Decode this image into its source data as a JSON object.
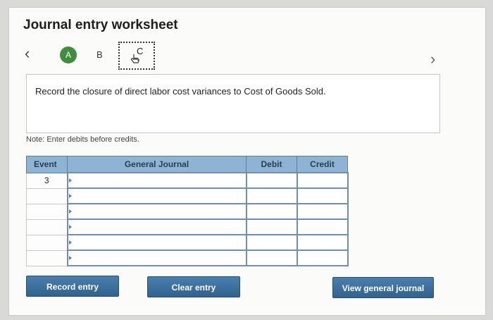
{
  "worksheet": {
    "title": "Journal entry worksheet",
    "steps": [
      {
        "label": "A",
        "state": "completed"
      },
      {
        "label": "B",
        "state": "pending"
      },
      {
        "label": "C",
        "state": "active"
      }
    ],
    "instruction": "Record the closure of direct labor cost variances to Cost of Goods Sold.",
    "note": "Note: Enter debits before credits."
  },
  "table": {
    "headers": {
      "event": "Event",
      "journal": "General Journal",
      "debit": "Debit",
      "credit": "Credit"
    },
    "rows": [
      {
        "event": "3",
        "journal": "",
        "debit": "",
        "credit": ""
      },
      {
        "event": "",
        "journal": "",
        "debit": "",
        "credit": ""
      },
      {
        "event": "",
        "journal": "",
        "debit": "",
        "credit": ""
      },
      {
        "event": "",
        "journal": "",
        "debit": "",
        "credit": ""
      },
      {
        "event": "",
        "journal": "",
        "debit": "",
        "credit": ""
      },
      {
        "event": "",
        "journal": "",
        "debit": "",
        "credit": ""
      }
    ]
  },
  "buttons": {
    "record": "Record entry",
    "clear": "Clear entry",
    "view": "View general journal"
  },
  "icons": {
    "prev": "chevron-left-icon",
    "next": "chevron-right-icon",
    "hand": "hand-pointer-icon"
  },
  "colors": {
    "accent": "#30638f",
    "step_complete": "#3e8e3e",
    "header_bg": "#8fb3d4"
  }
}
